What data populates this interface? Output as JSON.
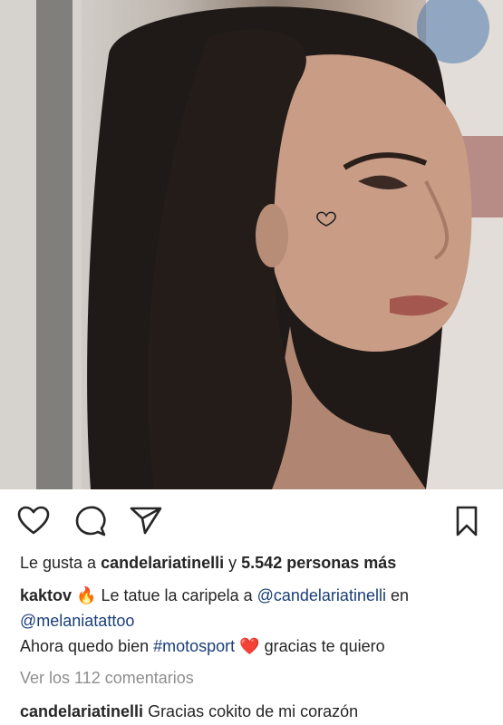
{
  "post": {
    "likes": {
      "prefix": "Le gusta a ",
      "user": "candelariatinelli",
      "middle": " y ",
      "count": "5.542 personas más"
    },
    "caption": {
      "author": "kaktov",
      "emoji_fire": "🔥",
      "text1": " Le tatue la caripela a ",
      "mention1": "@candelariatinelli",
      "text2": " en",
      "mention2": "@melaniatattoo",
      "line3_start": "Ahora quedo bien ",
      "hashtag": "#motosport",
      "emoji_heart": "❤️",
      "line3_end": " gracias te quiero"
    },
    "view_comments": "Ver los 112 comentarios",
    "comment": {
      "user": "candelariatinelli",
      "text": " Gracias cokito de mi corazón"
    }
  },
  "icons": [
    "heart-icon",
    "comment-icon",
    "share-icon",
    "bookmark-icon"
  ]
}
